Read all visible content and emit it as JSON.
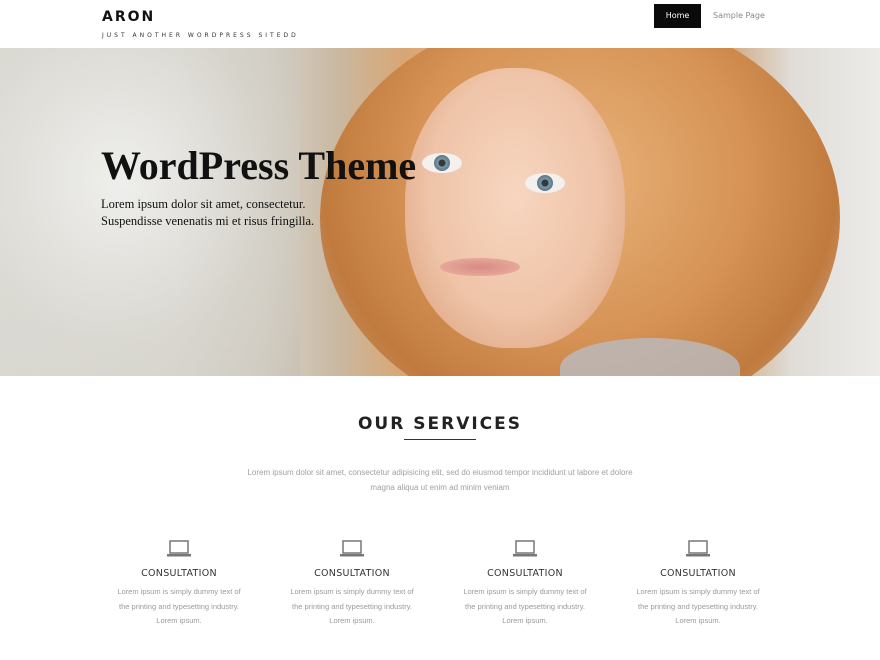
{
  "header": {
    "site_title": "ARON",
    "tagline": "JUST ANOTHER WORDPRESS SITEDD",
    "nav": [
      {
        "label": "Home",
        "active": true
      },
      {
        "label": "Sample Page",
        "active": false
      }
    ]
  },
  "hero": {
    "title": "WordPress Theme",
    "subtitle_line1": "Lorem ipsum dolor sit amet, consectetur.",
    "subtitle_line2": "Suspendisse venenatis mi et risus fringilla."
  },
  "services": {
    "title": "OUR SERVICES",
    "intro_line1": "Lorem ipsum dolor sit amet, consectetur adipisicing elit, sed do eiusmod tempor incididunt ut labore et dolore",
    "intro_line2": "magna aliqua ut enim ad minim veniam",
    "items": [
      {
        "icon": "laptop-icon",
        "title": "CONSULTATION",
        "text_line1": "Lorem ipsum is simply dummy text of",
        "text_line2": "the printing and typesetting industry.",
        "text_line3": "Lorem ipsum."
      },
      {
        "icon": "laptop-icon",
        "title": "CONSULTATION",
        "text_line1": "Lorem ipsum is simply dummy text of",
        "text_line2": "the printing and typesetting industry.",
        "text_line3": "Lorem ipsum."
      },
      {
        "icon": "laptop-icon",
        "title": "CONSULTATION",
        "text_line1": "Lorem ipsum is simply dummy text of",
        "text_line2": "the printing and typesetting industry.",
        "text_line3": "Lorem ipsum."
      },
      {
        "icon": "laptop-icon",
        "title": "CONSULTATION",
        "text_line1": "Lorem ipsum is simply dummy text of",
        "text_line2": "the printing and typesetting industry.",
        "text_line3": "Lorem ipsum."
      }
    ]
  },
  "colors": {
    "nav_active_bg": "#0a0a0a",
    "text_dark": "#111111",
    "text_muted": "#9a9a9a"
  }
}
